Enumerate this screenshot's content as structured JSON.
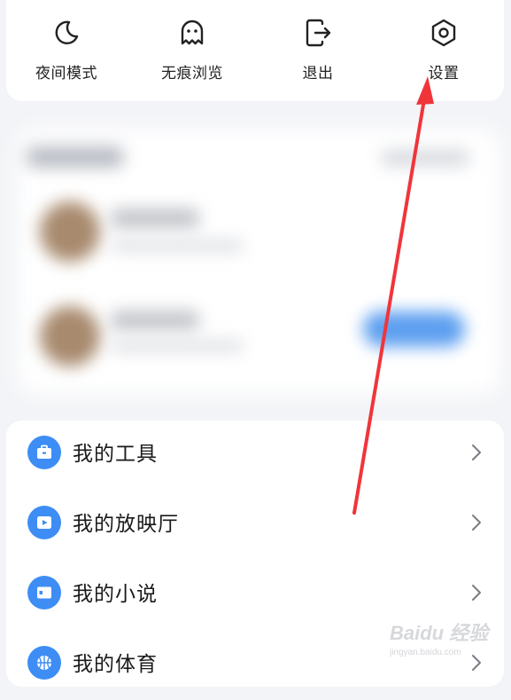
{
  "quick_tools": [
    {
      "label": "夜间模式",
      "icon": "moon-icon"
    },
    {
      "label": "无痕浏览",
      "icon": "ghost-icon"
    },
    {
      "label": "退出",
      "icon": "logout-icon"
    },
    {
      "label": "设置",
      "icon": "settings-hexagon-icon"
    }
  ],
  "menu": [
    {
      "label": "我的工具",
      "icon": "toolbox-icon"
    },
    {
      "label": "我的放映厅",
      "icon": "play-screen-icon"
    },
    {
      "label": "我的小说",
      "icon": "book-icon"
    },
    {
      "label": "我的体育",
      "icon": "basketball-icon"
    }
  ],
  "watermark": {
    "main": "Baidu 经验",
    "sub": "jingyan.baidu.com"
  },
  "colors": {
    "accent": "#3d8df5",
    "annotation_arrow": "#f0353a",
    "background": "#f3f4f7"
  }
}
